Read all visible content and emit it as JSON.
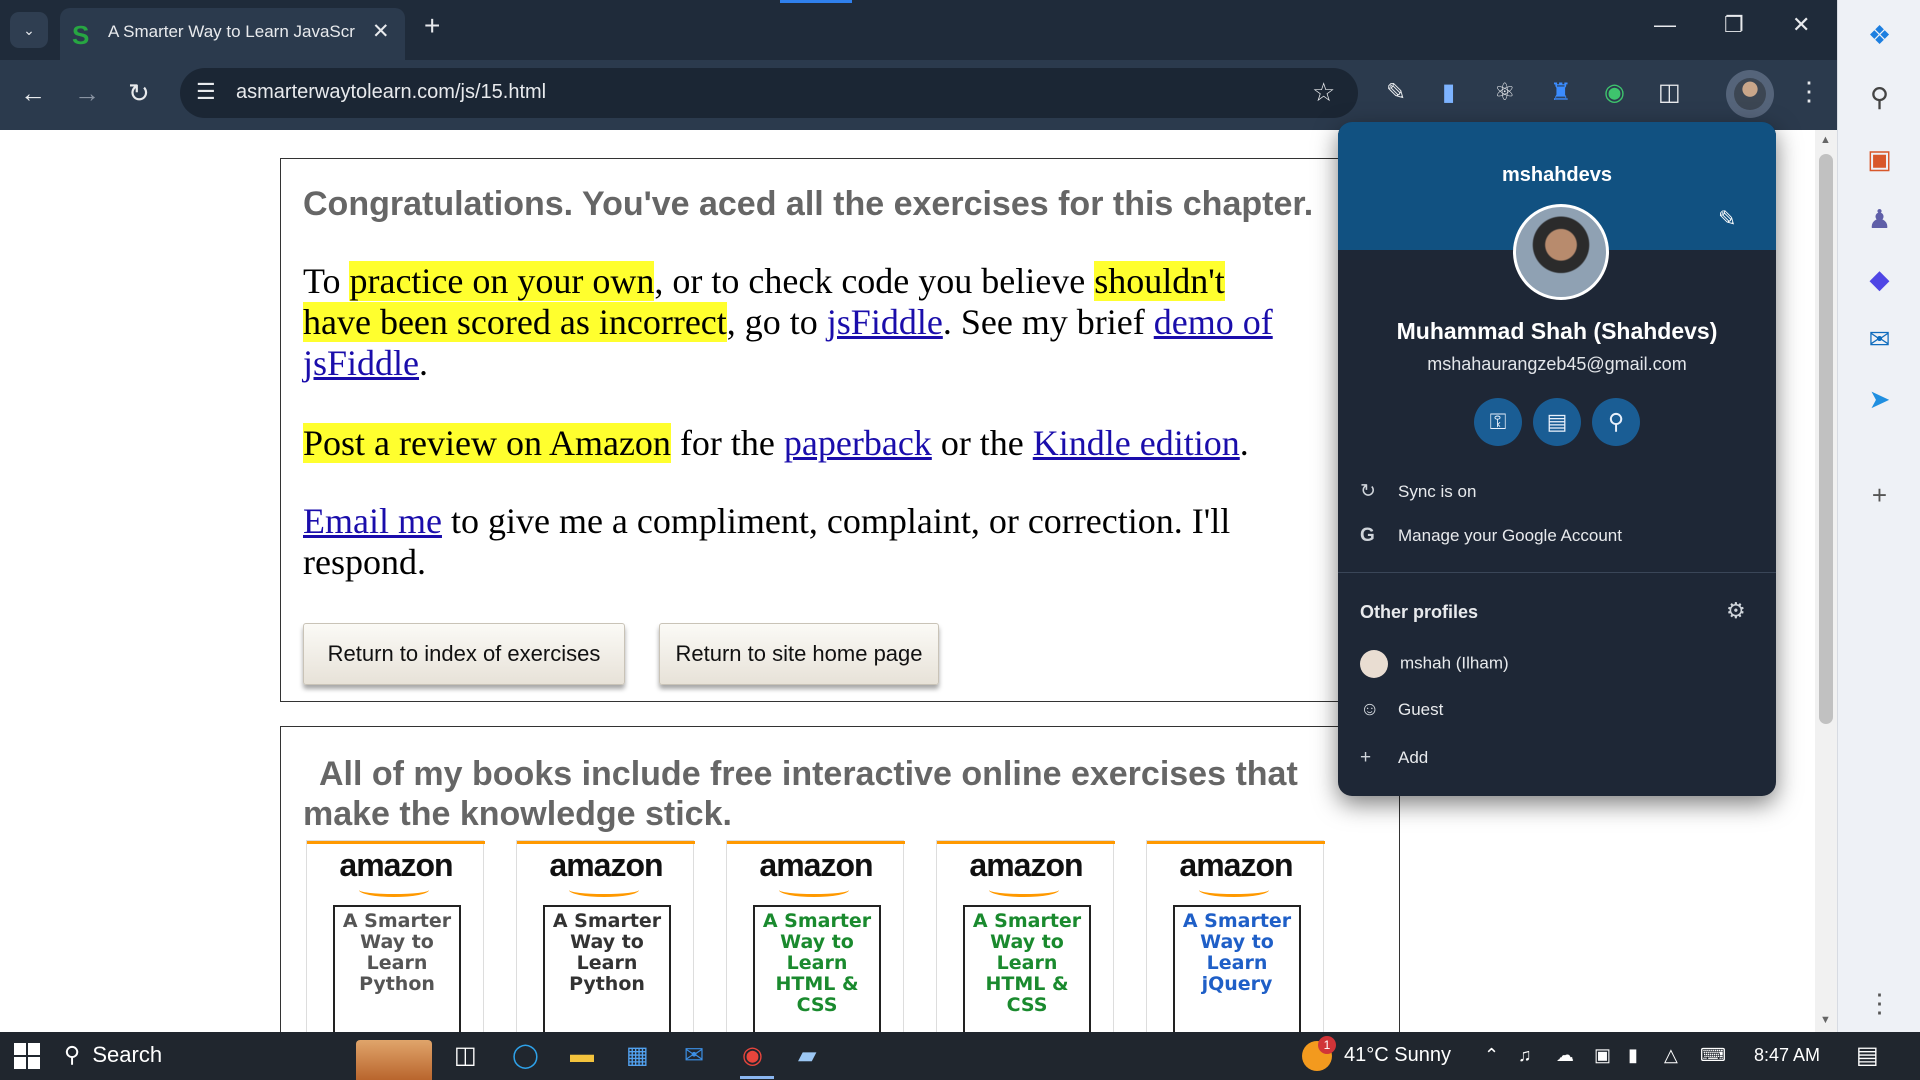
{
  "browser": {
    "tab_title": "A Smarter Way to Learn JavaScr",
    "tab_favicon": "S",
    "url": "asmarterwaytolearn.com/js/15.html"
  },
  "page": {
    "congrats_heading": "Congratulations. You've aced all the exercises for this chapter.",
    "para1": {
      "t1": "To ",
      "h1": "practice on your own",
      "t2": ", or to check code you believe ",
      "h2a": "shouldn't",
      "h2b": "have been scored as incorrect",
      "t3": ", go to ",
      "link1": "jsFiddle",
      "t4": ". See my brief ",
      "link2": "demo of",
      "link3": "jsFiddle",
      "t5": "."
    },
    "para2": {
      "h1": "Post a review on Amazon",
      "t1": " for the ",
      "link1": "paperback",
      "t2": " or the ",
      "link2": "Kindle edition",
      "t3": "."
    },
    "para3": {
      "link1": "Email me",
      "t1": " to give me a compliment, complaint, or correction. I'll",
      "t2": "respond."
    },
    "buttons": {
      "index": "Return to index of exercises",
      "home": "Return to site home page"
    },
    "books_heading_l1": "All of my books include free interactive online exercises that",
    "books_heading_l2": "make the knowledge stick.",
    "books": [
      {
        "brand": "amazon",
        "l1": "A Smarter",
        "l2": "Way to",
        "l3": "Learn",
        "l4": "Python",
        "color": "#555555"
      },
      {
        "brand": "amazon",
        "l1": "A Smarter",
        "l2": "Way to",
        "l3": "Learn",
        "l4": "Python",
        "color": "#333333"
      },
      {
        "brand": "amazon",
        "l1": "A Smarter",
        "l2": "Way to",
        "l3": "Learn",
        "l4": "HTML & CSS",
        "color": "#1a8a2e"
      },
      {
        "brand": "amazon",
        "l1": "A Smarter",
        "l2": "Way to",
        "l3": "Learn",
        "l4": "HTML & CSS",
        "color": "#1a8a2e"
      },
      {
        "brand": "amazon",
        "l1": "A Smarter",
        "l2": "Way to",
        "l3": "Learn",
        "l4": "jQuery",
        "color": "#1f5fc7"
      }
    ]
  },
  "profile": {
    "username": "mshahdevs",
    "full_name": "Muhammad Shah (Shahdevs)",
    "email": "mshahaurangzeb45@gmail.com",
    "sync": "Sync is on",
    "manage": "Manage your Google Account",
    "other_profiles": "Other profiles",
    "profiles": [
      "mshah (Ilham)",
      "Guest",
      "Add"
    ]
  },
  "taskbar": {
    "search": "Search",
    "weather": "41°C  Sunny",
    "weather_badge": "1",
    "time": "8:47 AM"
  },
  "icons": {
    "accent": "#115181",
    "highlight": "#ffff2e",
    "link": "#1a0dab"
  }
}
